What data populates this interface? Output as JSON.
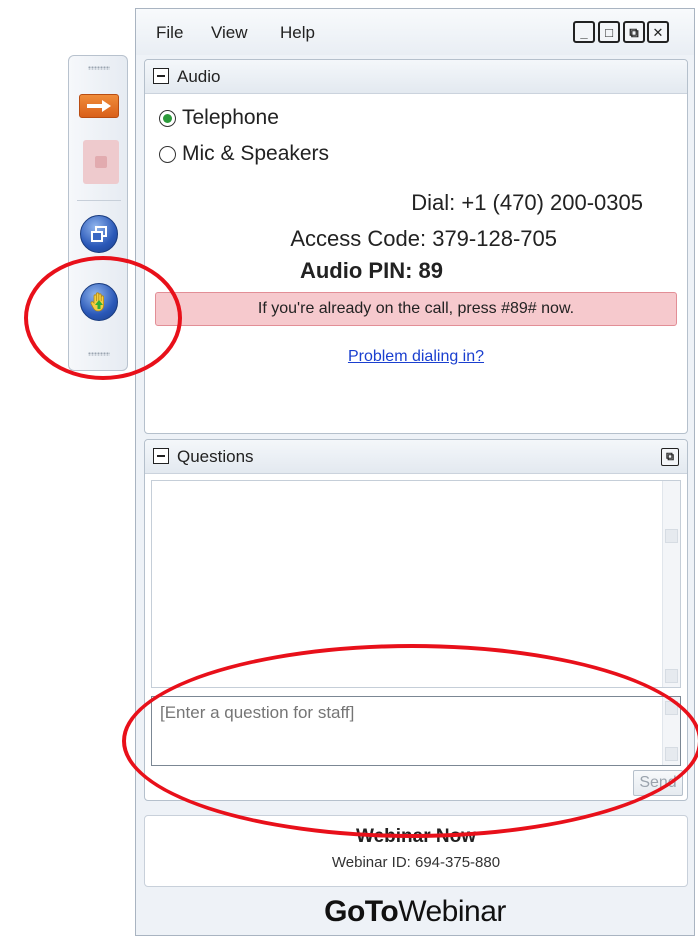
{
  "menu": {
    "file": "File",
    "view": "View",
    "help": "Help"
  },
  "window_controls": {
    "minimize": "_",
    "maximize": "□",
    "restore": "⧉",
    "close": "✕"
  },
  "audio": {
    "title": "Audio",
    "options": [
      {
        "label": "Telephone",
        "selected": true
      },
      {
        "label": "Mic & Speakers",
        "selected": false
      }
    ],
    "dial": "Dial: +1 (470) 200-0305",
    "access_code": "Access Code: 379-128-705",
    "audio_pin": "Audio PIN: 89",
    "notice": "If you're already on the call, press #89# now.",
    "help_link": "Problem dialing in?"
  },
  "questions": {
    "title": "Questions",
    "input_placeholder": "[Enter a question for staff]",
    "send_label": "Send"
  },
  "webinar": {
    "name": "Webinar Now",
    "id_text": "Webinar ID: 694-375-880"
  },
  "brand": {
    "bold": "GoTo",
    "light": "Webinar"
  },
  "colors": {
    "annotation": "#e8101a",
    "notice_bg": "#f6c9cd",
    "link": "#1a3fcf",
    "radio_selected": "#2b9a3a",
    "arrow_button": "#e3732a",
    "round_button": "#2a58b8"
  }
}
